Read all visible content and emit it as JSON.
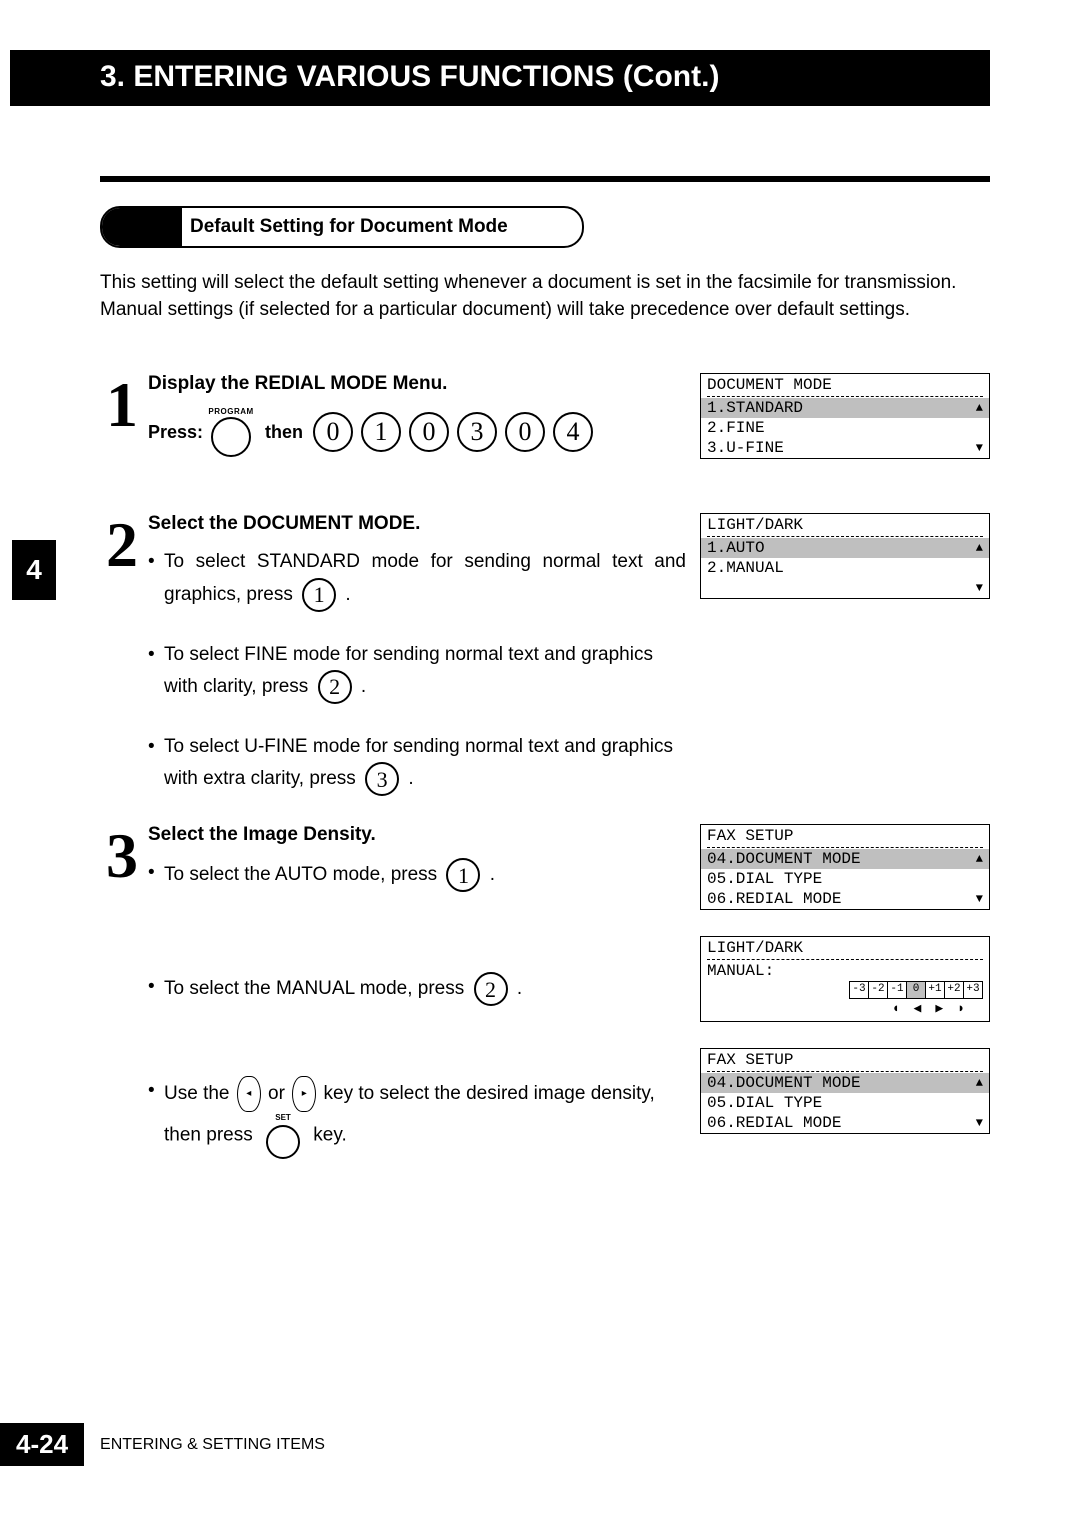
{
  "title_bar": "3. ENTERING VARIOUS FUNCTIONS (Cont.)",
  "side_tab": "4",
  "capsule_label": "Default Setting for Document Mode",
  "intro": "This setting will select the default setting whenever a document is set in the facsimile for transmission. Manual settings (if selected for a particular document) will take precedence over default settings.",
  "step1": {
    "num": "1",
    "head": "Display the REDIAL MODE Menu.",
    "press_label": "Press:",
    "then_label": "then",
    "prog_label": "PROGRAM",
    "digits": [
      "0",
      "1",
      "0",
      "3",
      "0",
      "4"
    ]
  },
  "step2": {
    "num": "2",
    "head": "Select the DOCUMENT MODE.",
    "b1a": "To select STANDARD mode for sending normal text and graphics, press",
    "b1k": "1",
    "b2a": "To select FINE mode for sending normal text and graphics with clarity, press",
    "b2k": "2",
    "b3a": "To select U-FINE mode for sending normal text and graphics with extra clarity, press",
    "b3k": "3"
  },
  "step3": {
    "num": "3",
    "head": "Select the Image Density.",
    "b1a": "To select the AUTO mode, press",
    "b1k": "1",
    "b2a": "To select the MANUAL mode, press",
    "b2k": "2",
    "b3a": "Use the",
    "b3b": "or",
    "b3c": "key to select the desired image density, then press",
    "b3d": "key.",
    "set_label": "SET"
  },
  "lcd1": {
    "title": "DOCUMENT MODE",
    "r1": "1.STANDARD",
    "r2": "2.FINE",
    "r3": "3.U-FINE"
  },
  "lcd2": {
    "title": "LIGHT/DARK",
    "r1": "1.AUTO",
    "r2": "2.MANUAL"
  },
  "lcd3": {
    "title": "FAX SETUP",
    "r1": "04.DOCUMENT MODE",
    "r2": "05.DIAL TYPE",
    "r3": "06.REDIAL MODE"
  },
  "lcd4": {
    "title": "LIGHT/DARK",
    "r1": "MANUAL:",
    "scale": [
      "-3",
      "-2",
      "-1",
      "0",
      "+1",
      "+2",
      "+3"
    ]
  },
  "lcd5": {
    "title": "FAX SETUP",
    "r1": "04.DOCUMENT MODE",
    "r2": "05.DIAL TYPE",
    "r3": "06.REDIAL MODE"
  },
  "arrows": {
    "up": "▲",
    "down": "▼",
    "left": "◀",
    "right": "▶",
    "lh": "◖",
    "rh": "◗"
  },
  "footer": {
    "page": "4-24",
    "section": "ENTERING & SETTING ITEMS"
  }
}
